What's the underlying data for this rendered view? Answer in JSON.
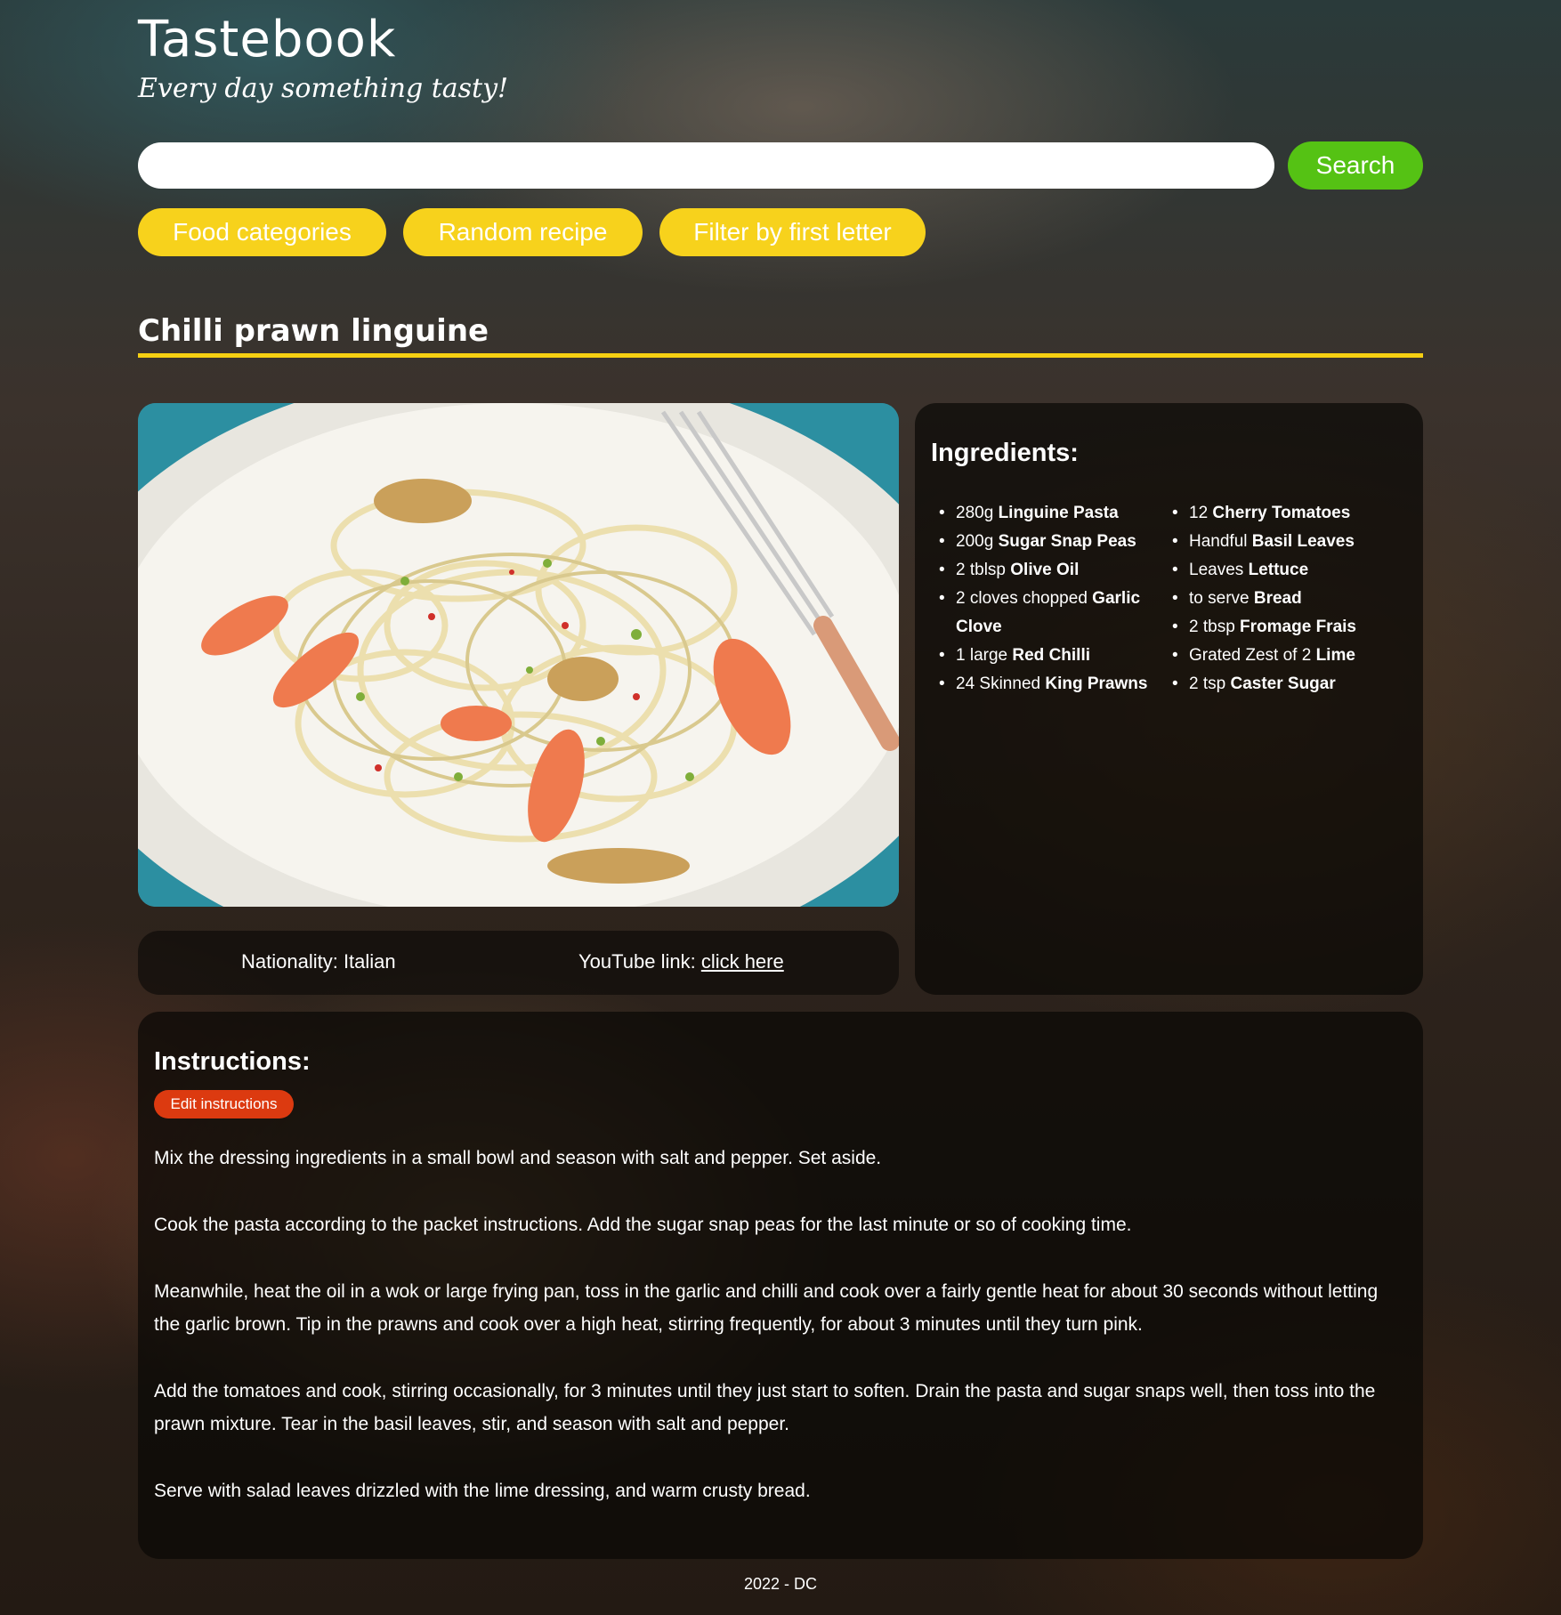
{
  "header": {
    "site_title": "Tastebook",
    "tagline": "Every day something tasty!"
  },
  "search": {
    "value": "",
    "placeholder": "",
    "button_label": "Search"
  },
  "nav": {
    "food_categories": "Food categories",
    "random_recipe": "Random recipe",
    "filter_first_letter": "Filter by first letter"
  },
  "colors": {
    "search_button": "#55c214",
    "nav_pill": "#f7d21c",
    "title_rule": "#f5cf12",
    "edit_button": "#dc3a10"
  },
  "recipe": {
    "title": "Chilli prawn linguine",
    "image_alt": "Chilli prawn linguine",
    "nationality_label": "Nationality: Italian",
    "youtube_label": "YouTube link: ",
    "youtube_link_text": "click here",
    "ingredients_title": "Ingredients:",
    "ingredients_col1": [
      {
        "qty": "280g",
        "name": "Linguine Pasta"
      },
      {
        "qty": "200g",
        "name": "Sugar Snap Peas"
      },
      {
        "qty": "2 tblsp",
        "name": "Olive Oil"
      },
      {
        "qty": "2 cloves chopped",
        "name": "Garlic Clove"
      },
      {
        "qty": "1 large",
        "name": "Red Chilli"
      },
      {
        "qty": "24 Skinned",
        "name": "King Prawns"
      }
    ],
    "ingredients_col2": [
      {
        "qty": "12",
        "name": "Cherry Tomatoes"
      },
      {
        "qty": "Handful",
        "name": "Basil Leaves"
      },
      {
        "qty": "Leaves",
        "name": "Lettuce"
      },
      {
        "qty": "to serve",
        "name": "Bread"
      },
      {
        "qty": "2 tbsp",
        "name": "Fromage Frais"
      },
      {
        "qty": "Grated Zest of 2",
        "name": "Lime"
      },
      {
        "qty": "2 tsp",
        "name": "Caster Sugar"
      }
    ],
    "instructions_title": "Instructions:",
    "edit_button_label": "Edit instructions",
    "instructions": [
      "Mix the dressing ingredients in a small bowl and season with salt and pepper. Set aside.",
      "Cook the pasta according to the packet instructions. Add the sugar snap peas for the last minute or so of cooking time.",
      "Meanwhile, heat the oil in a wok or large frying pan, toss in the garlic and chilli and cook over a fairly gentle heat for about 30 seconds without letting the garlic brown. Tip in the prawns and cook over a high heat, stirring frequently, for about 3 minutes until they turn pink.",
      "Add the tomatoes and cook, stirring occasionally, for 3 minutes until they just start to soften. Drain the pasta and sugar snaps well, then toss into the prawn mixture. Tear in the basil leaves, stir, and season with salt and pepper.",
      "Serve with salad leaves drizzled with the lime dressing, and warm crusty bread."
    ]
  },
  "footer": {
    "text": "2022 - DC"
  }
}
